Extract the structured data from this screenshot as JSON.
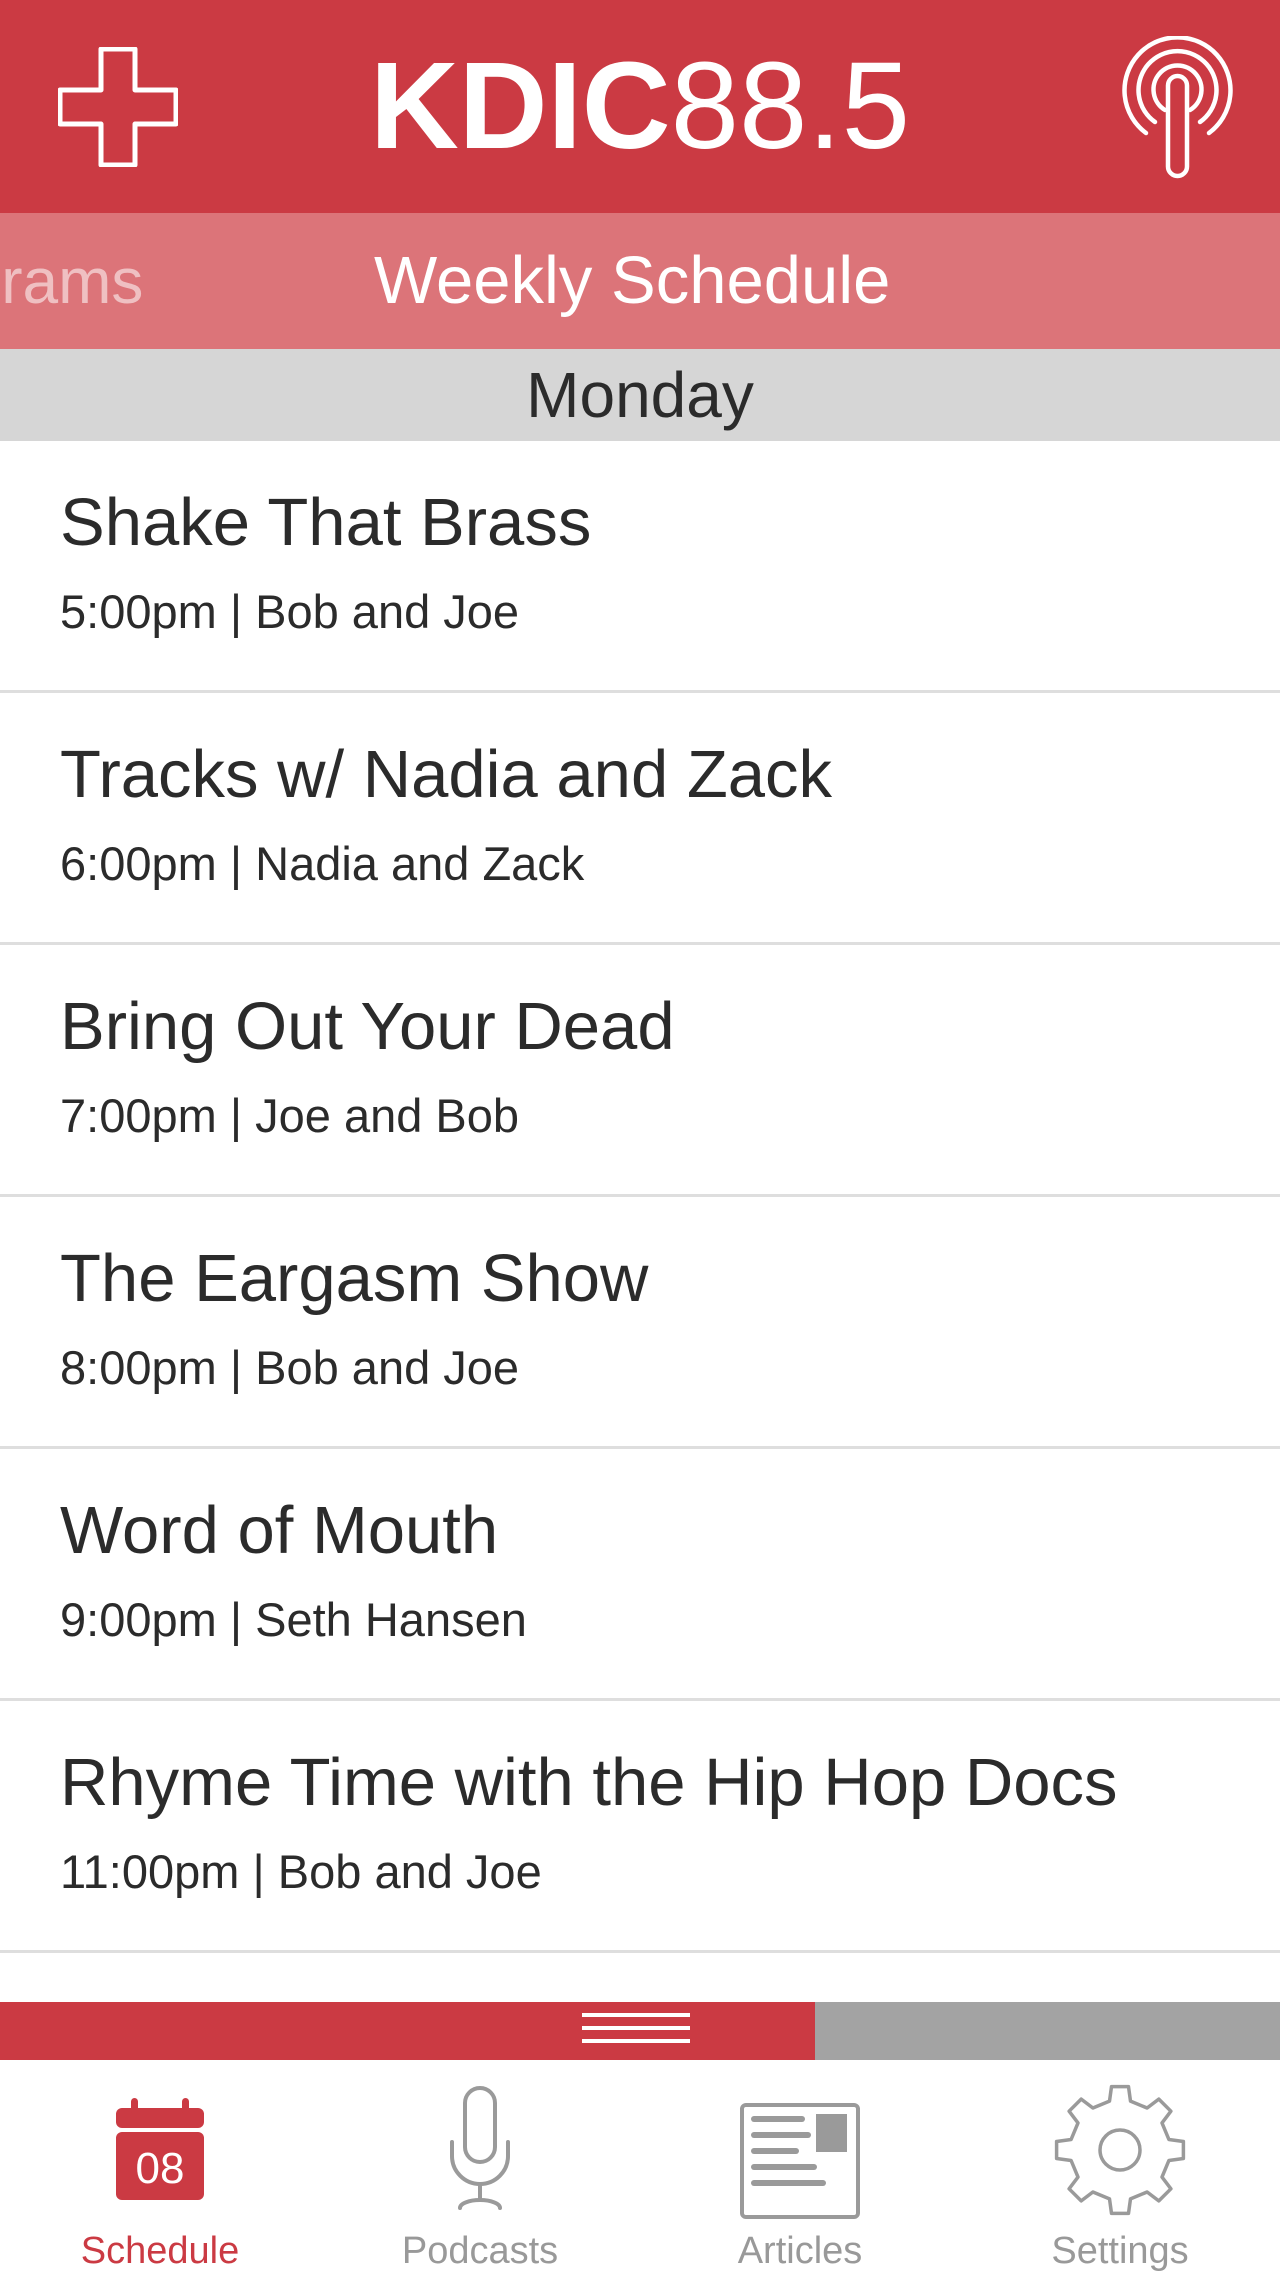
{
  "header": {
    "call_sign": "KDIC",
    "frequency": "88.5",
    "add_icon": "plus-icon",
    "stream_icon": "podcast-broadcast-icon"
  },
  "subnav": {
    "previous_label": "ograms",
    "current_label": "Weekly Schedule"
  },
  "schedule": {
    "day": "Monday",
    "shows": [
      {
        "title": "Shake That Brass",
        "time": "5:00pm",
        "hosts": "Bob and Joe"
      },
      {
        "title": "Tracks w/ Nadia and Zack",
        "time": "6:00pm",
        "hosts": "Nadia and Zack"
      },
      {
        "title": "Bring Out Your Dead",
        "time": "7:00pm",
        "hosts": "Joe and Bob"
      },
      {
        "title": "The Eargasm Show",
        "time": "8:00pm",
        "hosts": "Bob and Joe"
      },
      {
        "title": "Word of Mouth",
        "time": "9:00pm",
        "hosts": "Seth Hansen"
      },
      {
        "title": "Rhyme Time with the Hip Hop Docs",
        "time": "11:00pm",
        "hosts": "Bob and Joe"
      }
    ],
    "separator": "|"
  },
  "player": {
    "progress": 0.637
  },
  "tabbar": {
    "tabs": [
      {
        "label": "Schedule",
        "icon": "calendar-icon",
        "calendar_date": "08",
        "active": true
      },
      {
        "label": "Podcasts",
        "icon": "microphone-icon",
        "active": false
      },
      {
        "label": "Articles",
        "icon": "newspaper-icon",
        "active": false
      },
      {
        "label": "Settings",
        "icon": "gear-icon",
        "active": false
      }
    ]
  },
  "colors": {
    "brand_red": "#cb3a43",
    "subnav_pink": "#dc7479",
    "day_header_gray": "#d6d6d6",
    "inactive_gray": "#999999"
  }
}
